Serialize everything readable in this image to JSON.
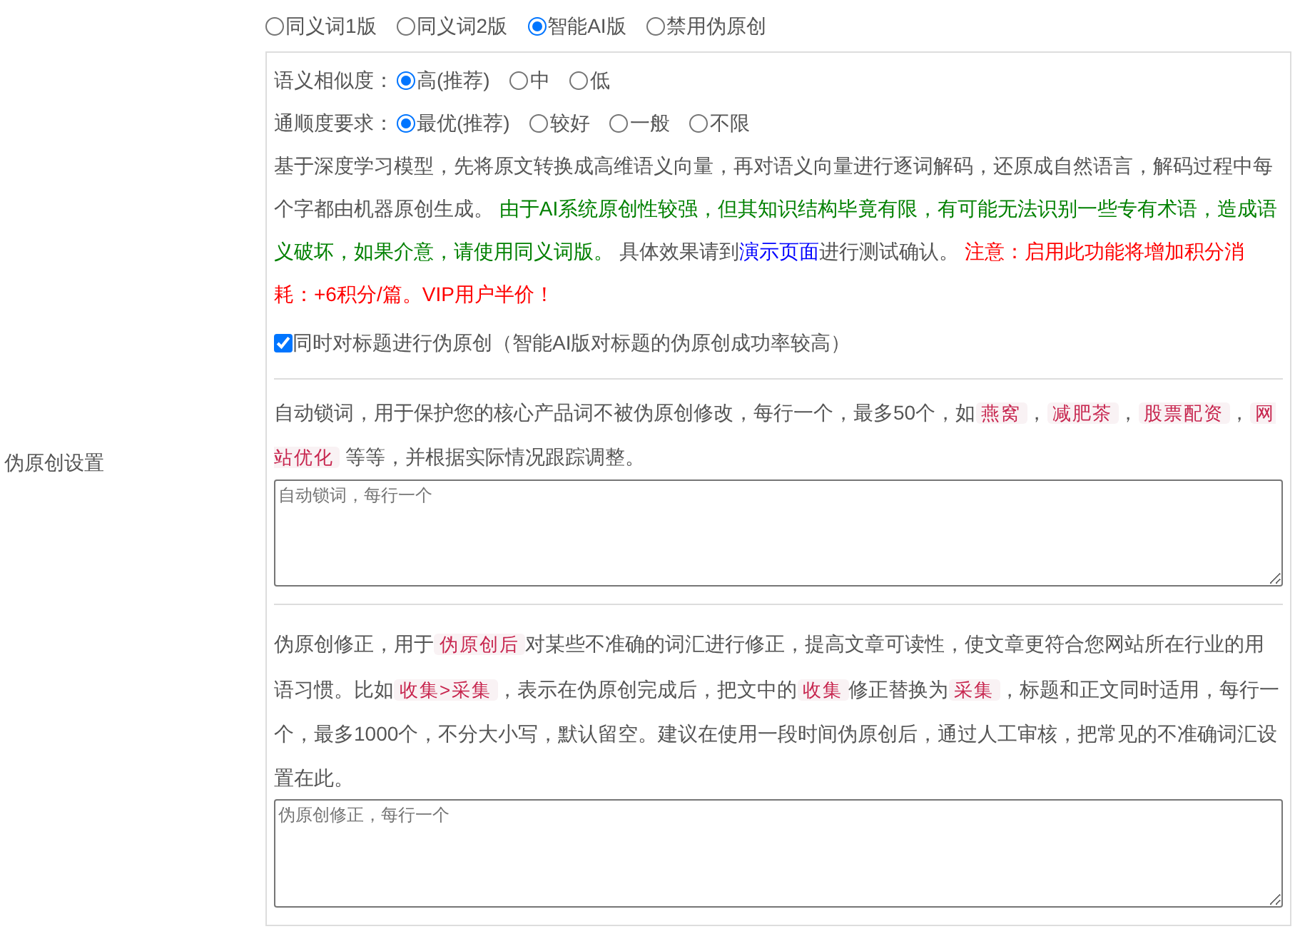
{
  "section_label": "伪原创设置",
  "modes": [
    {
      "label": "同义词1版",
      "selected": false
    },
    {
      "label": "同义词2版",
      "selected": false
    },
    {
      "label": "智能AI版",
      "selected": true
    },
    {
      "label": "禁用伪原创",
      "selected": false
    }
  ],
  "similarity": {
    "label": "语义相似度：",
    "options": [
      {
        "label": "高(推荐)",
        "selected": true
      },
      {
        "label": "中",
        "selected": false
      },
      {
        "label": "低",
        "selected": false
      }
    ]
  },
  "fluency": {
    "label": "通顺度要求：",
    "options": [
      {
        "label": "最优(推荐)",
        "selected": true
      },
      {
        "label": "较好",
        "selected": false
      },
      {
        "label": "一般",
        "selected": false
      },
      {
        "label": "不限",
        "selected": false
      }
    ]
  },
  "ai_description": [
    {
      "kind": "plain",
      "text": "基于深度学习模型，先将原文转换成高维语义向量，再对语义向量进行逐词解码，还原成自然语言，解码过程中每个字都由机器原创生成。 "
    },
    {
      "kind": "green",
      "text": "由于AI系统原创性较强，但其知识结构毕竟有限，有可能无法识别一些专有术语，造成语义破坏，如果介意，请使用同义词版。"
    },
    {
      "kind": "plain",
      "text": " 具体效果请到"
    },
    {
      "kind": "link",
      "text": "演示页面"
    },
    {
      "kind": "plain",
      "text": "进行测试确认。 "
    },
    {
      "kind": "red",
      "text": "注意：启用此功能将增加积分消耗：+6积分/篇。VIP用户半价！"
    }
  ],
  "title_checkbox": {
    "label": "同时对标题进行伪原创（智能AI版对标题的伪原创成功率较高）",
    "checked": true
  },
  "lock_words": {
    "description": [
      {
        "kind": "plain",
        "text": "自动锁词，用于保护您的核心产品词不被伪原创修改，每行一个，最多50个，如"
      },
      {
        "kind": "code",
        "text": "燕窝"
      },
      {
        "kind": "plain",
        "text": "，"
      },
      {
        "kind": "code",
        "text": "减肥茶"
      },
      {
        "kind": "plain",
        "text": "，"
      },
      {
        "kind": "code",
        "text": "股票配资"
      },
      {
        "kind": "plain",
        "text": "，"
      },
      {
        "kind": "code",
        "text": "网站优化"
      },
      {
        "kind": "plain",
        "text": " 等等，并根据实际情况跟踪调整。"
      }
    ],
    "placeholder": "自动锁词，每行一个"
  },
  "correction": {
    "description": [
      {
        "kind": "plain",
        "text": "伪原创修正，用于"
      },
      {
        "kind": "code",
        "text": "伪原创后"
      },
      {
        "kind": "plain",
        "text": "对某些不准确的词汇进行修正，提高文章可读性，使文章更符合您网站所在行业的用语习惯。比如"
      },
      {
        "kind": "code",
        "text": "收集>采集"
      },
      {
        "kind": "plain",
        "text": "，表示在伪原创完成后，把文中的"
      },
      {
        "kind": "code",
        "text": "收集"
      },
      {
        "kind": "plain",
        "text": "修正替换为"
      },
      {
        "kind": "code",
        "text": "采集"
      },
      {
        "kind": "plain",
        "text": "，标题和正文同时适用，每行一个，最多1000个，不分大小写，默认留空。建议在使用一段时间伪原创后，通过人工审核，把常见的不准确词汇设置在此。"
      }
    ],
    "placeholder": "伪原创修正，每行一个"
  }
}
